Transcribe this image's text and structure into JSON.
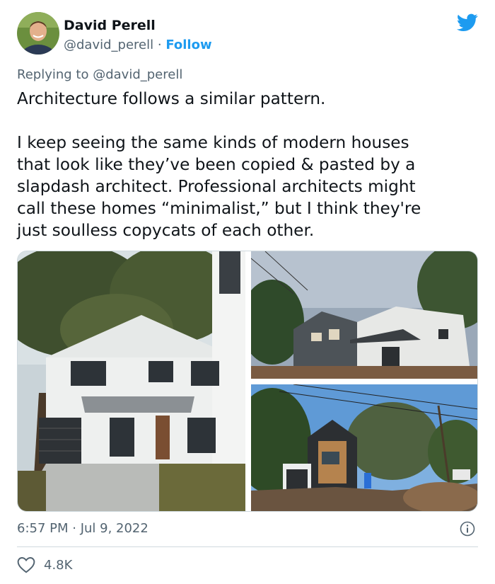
{
  "author": {
    "name": "David Perell",
    "handle": "@david_perell",
    "separator": "·",
    "follow_label": "Follow"
  },
  "reply": {
    "prefix": "Replying to",
    "mention": "@david_perell"
  },
  "tweet": {
    "paragraph1": "Architecture follows a similar pattern.",
    "paragraph2": "I keep seeing the same kinds of modern houses\nthat look like they’ve been copied & pasted by a\nslapdash architect. Professional architects might\ncall these homes “minimalist,” but I think they're\njust soulless copycats of each other."
  },
  "meta": {
    "timestamp": "6:57 PM · Jul 9, 2022",
    "likes": "4.8K"
  },
  "icons": {
    "brand": "twitter-bird-icon",
    "info": "info-icon",
    "like": "heart-icon"
  },
  "colors": {
    "accent": "#1d9bf0",
    "text": "#0f1419",
    "secondary": "#536471",
    "border": "#cfd9de"
  }
}
